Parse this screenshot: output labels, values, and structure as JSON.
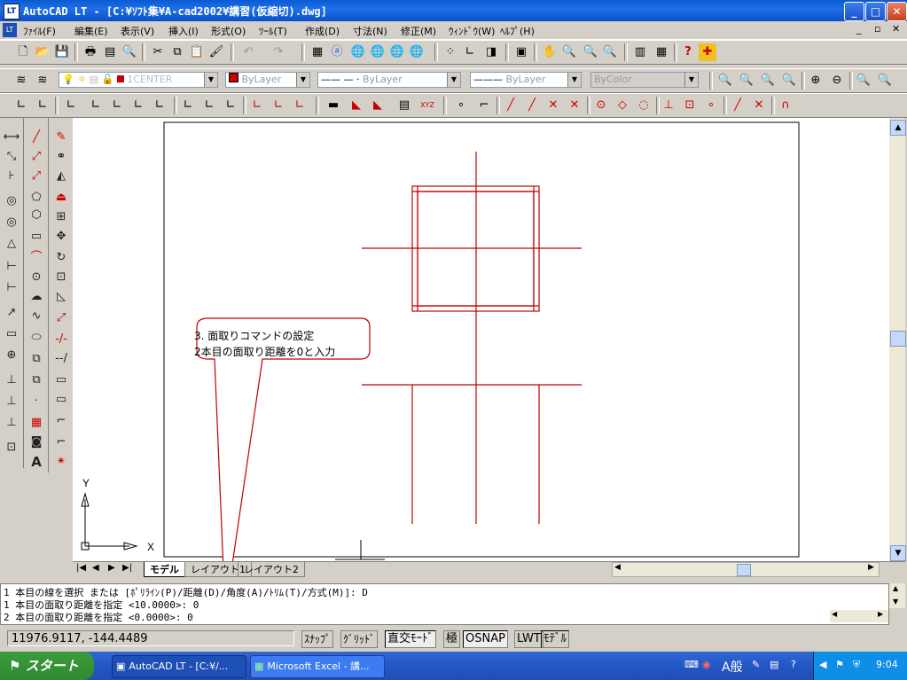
{
  "window": {
    "title": "AutoCAD LT - [C:¥ｿﾌﾄ集¥A-cad2002¥講習(仮縮切).dwg]",
    "app_icon_text": "LT"
  },
  "menu": {
    "app_icon_text": "LT",
    "items": [
      "ﾌｧｲﾙ(F)",
      "編集(E)",
      "表示(V)",
      "挿入(I)",
      "形式(O)",
      "ﾂｰﾙ(T)",
      "作成(D)",
      "寸法(N)",
      "修正(M)",
      "ｳｨﾝﾄﾞｳ(W)",
      "ﾍﾙﾌﾟ(H)"
    ]
  },
  "layers": {
    "current_layer": "1CENTER",
    "color": "ByLayer",
    "linetype": "ByLayer",
    "lineweight": "ByLayer",
    "plotstyle": "ByColor"
  },
  "tabs": [
    "モデル",
    "レイアウト1",
    "レイアウト2"
  ],
  "callout": {
    "line1": "3. 面取りコマンドの設定",
    "line2": "2本目の面取り距離を0と入力"
  },
  "ucs": {
    "x_label": "X",
    "y_label": "Y"
  },
  "command_lines": [
    "1 本目の線を選択 または [ﾎﾟﾘﾗｲﾝ(P)/距離(D)/角度(A)/ﾄﾘﾑ(T)/方式(M)]: D",
    "1 本目の面取り距離を指定 <10.0000>: 0",
    "2 本目の面取り距離を指定 <0.0000>: 0"
  ],
  "status": {
    "coords": "11976.9117, -144.4489",
    "toggles": [
      "ｽﾅｯﾌﾟ",
      "ｸﾞﾘｯﾄﾞ",
      "直交ﾓｰﾄﾞ",
      "極",
      "OSNAP",
      "LWT",
      "ﾓﾃﾞﾙ"
    ]
  },
  "taskbar": {
    "start": "スタート",
    "tasks": [
      "AutoCAD LT - [C:¥/...",
      "Microsoft Excel - 講..."
    ],
    "tray_text": "A般",
    "clock": "9:04"
  },
  "colors": {
    "drawing_red": "#c00000",
    "title_blue": "#0a5ad4"
  }
}
